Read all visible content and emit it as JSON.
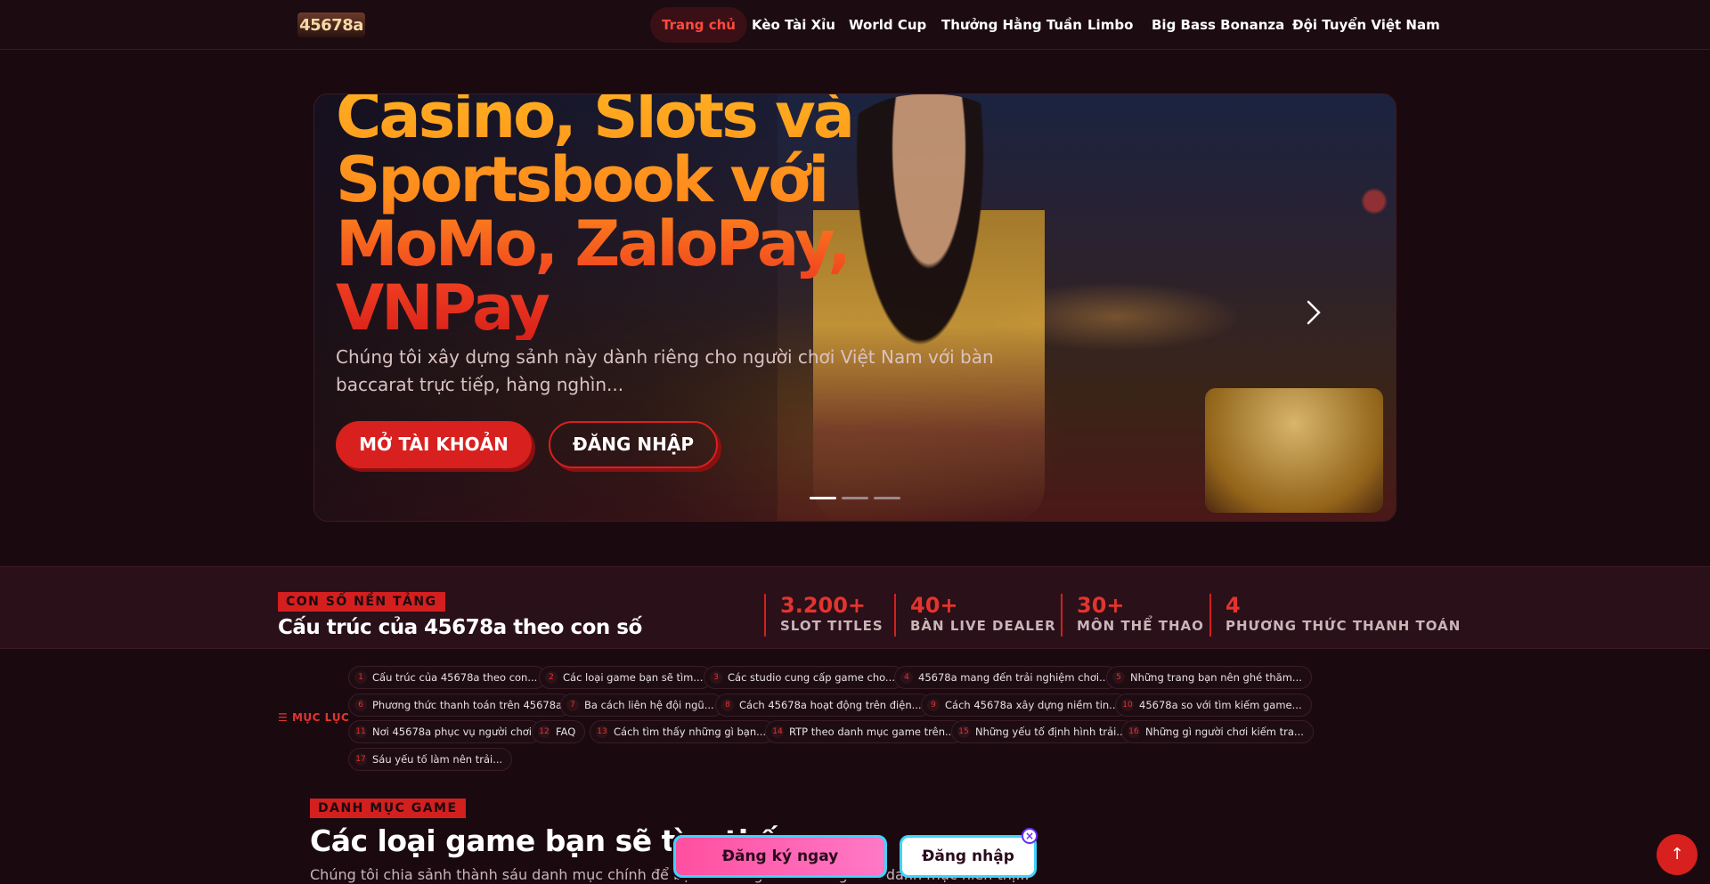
{
  "header": {
    "logo_text": "45678a",
    "nav": [
      {
        "label": "Trang chủ",
        "active": true
      },
      {
        "label": "Kèo Tài Xỉu"
      },
      {
        "label": "World Cup"
      },
      {
        "label": "Thưởng Hằng Tuần"
      },
      {
        "label": "Limbo"
      },
      {
        "label": "Big Bass Bonanza"
      },
      {
        "label": "Đội Tuyển Việt Nam"
      }
    ]
  },
  "hero": {
    "title": "Casino, Slots và Sportsbook với MoMo, ZaloPay, VNPay",
    "description": "Chúng tôi xây dựng sảnh này dành riêng cho người chơi Việt Nam với bàn baccarat trực tiếp, hàng nghìn...",
    "primary_button": "MỞ TÀI KHOẢN",
    "secondary_button": "ĐĂNG NHẬP",
    "slides_count": 3,
    "active_slide": 1
  },
  "stats": {
    "tag": "CON SỐ NỀN TẢNG",
    "title": "Cấu trúc của 45678a theo con số",
    "items": [
      {
        "value": "3.200+",
        "label": "SLOT TITLES"
      },
      {
        "value": "40+",
        "label": "BÀN LIVE DEALER"
      },
      {
        "value": "30+",
        "label": "MÔN THỂ THAO"
      },
      {
        "value": "4",
        "label": "PHƯƠNG THỨC THANH TOÁN"
      }
    ]
  },
  "toc": {
    "label": "MỤC LỤC",
    "items": [
      {
        "n": "1",
        "text": "Cấu trúc của 45678a theo con..."
      },
      {
        "n": "2",
        "text": "Các loại game bạn sẽ tìm..."
      },
      {
        "n": "3",
        "text": "Các studio cung cấp game cho..."
      },
      {
        "n": "4",
        "text": "45678a mang đến trải nghiệm chơi..."
      },
      {
        "n": "5",
        "text": "Những trang bạn nên ghé thăm..."
      },
      {
        "n": "6",
        "text": "Phương thức thanh toán trên 45678a"
      },
      {
        "n": "7",
        "text": "Ba cách liên hệ đội ngũ..."
      },
      {
        "n": "8",
        "text": "Cách 45678a hoạt động trên điện..."
      },
      {
        "n": "9",
        "text": "Cách 45678a xây dựng niềm tin..."
      },
      {
        "n": "10",
        "text": "45678a so với tìm kiếm game..."
      },
      {
        "n": "11",
        "text": "Nơi 45678a phục vụ người chơi"
      },
      {
        "n": "12",
        "text": "FAQ"
      },
      {
        "n": "13",
        "text": "Cách tìm thấy những gì bạn..."
      },
      {
        "n": "14",
        "text": "RTP theo danh mục game trên..."
      },
      {
        "n": "15",
        "text": "Những yếu tố định hình trải..."
      },
      {
        "n": "16",
        "text": "Những gì người chơi kiếm tra..."
      },
      {
        "n": "17",
        "text": "Sáu yếu tố làm nên trải..."
      }
    ]
  },
  "section": {
    "tag": "DANH MỤC GAME",
    "title": "Các loại game bạn sẽ tìm thấy...",
    "description": "Chúng tôi chia sảnh thành sáu danh mục chính để bạn dễ dàng điều hướng. Mỗi danh mục hiển thị..."
  },
  "sticky_cta": {
    "register": "Đăng ký ngay",
    "login": "Đăng nhập"
  },
  "colors": {
    "background": "#1a0a10",
    "accent": "#d8201f",
    "accent_text": "#e3342f",
    "cta_pink": "#ff4fa0",
    "cta_border": "#3fd3ff"
  },
  "icons": [
    "chevron-right-icon",
    "list-icon",
    "close-icon",
    "arrow-up-icon"
  ]
}
